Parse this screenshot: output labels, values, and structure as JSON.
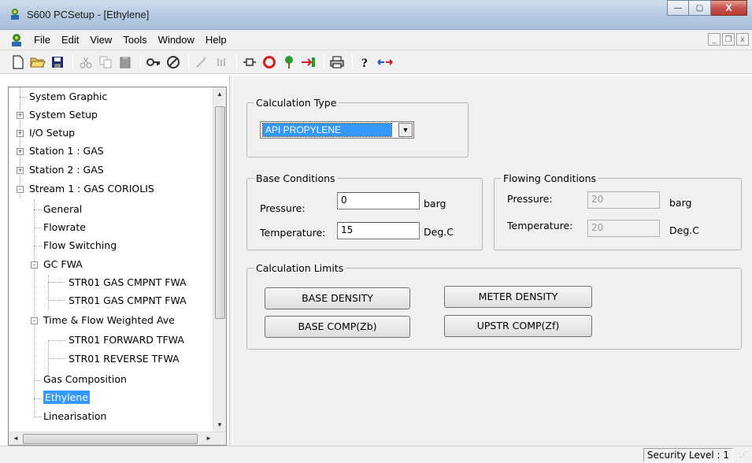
{
  "window": {
    "title": "S600 PCSetup - [Ethylene]",
    "controls": {
      "minimize": "—",
      "maximize": "▢",
      "close": "X"
    }
  },
  "menubar": {
    "items": [
      "File",
      "Edit",
      "View",
      "Tools",
      "Window",
      "Help"
    ],
    "mdi_controls": [
      "_",
      "❐",
      "x"
    ]
  },
  "toolbar": {
    "icons": [
      "new-file-icon",
      "open-folder-icon",
      "save-icon",
      "cut-icon",
      "copy-icon",
      "paste-icon",
      "key-icon",
      "connect-icon",
      "wand-icon",
      "bars-icon",
      "plug-icon",
      "circle-icon",
      "tree-icon",
      "arrow-into-icon",
      "printer-icon",
      "help-icon",
      "swap-arrows-icon"
    ]
  },
  "tree": {
    "items": [
      {
        "label": "System Graphic",
        "expander": "",
        "depth": 0
      },
      {
        "label": "System Setup",
        "expander": "+",
        "depth": 0
      },
      {
        "label": "I/O Setup",
        "expander": "+",
        "depth": 0
      },
      {
        "label": "Station 1 : GAS",
        "expander": "+",
        "depth": 0
      },
      {
        "label": "Station 2 : GAS",
        "expander": "+",
        "depth": 0
      },
      {
        "label": "Stream 1 : GAS CORIOLIS",
        "expander": "-",
        "depth": 0
      },
      {
        "label": "General",
        "expander": "",
        "depth": 1
      },
      {
        "label": "Flowrate",
        "expander": "",
        "depth": 1
      },
      {
        "label": "Flow Switching",
        "expander": "",
        "depth": 1
      },
      {
        "label": "GC FWA",
        "expander": "-",
        "depth": 1
      },
      {
        "label": "STR01 GAS CMPNT FWA",
        "expander": "",
        "depth": 2
      },
      {
        "label": "STR01 GAS CMPNT FWA",
        "expander": "",
        "depth": 2
      },
      {
        "label": "Time & Flow Weighted Ave",
        "expander": "-",
        "depth": 1
      },
      {
        "label": "STR01 FORWARD TFWA",
        "expander": "",
        "depth": 2
      },
      {
        "label": "STR01 REVERSE TFWA",
        "expander": "",
        "depth": 2
      },
      {
        "label": "Gas Composition",
        "expander": "",
        "depth": 1
      },
      {
        "label": "Ethylene",
        "expander": "",
        "depth": 1,
        "selected": true
      },
      {
        "label": "Linearisation",
        "expander": "",
        "depth": 1
      }
    ]
  },
  "calculation_type": {
    "legend": "Calculation Type",
    "selected": "API PROPYLENE"
  },
  "base_conditions": {
    "legend": "Base Conditions",
    "pressure_label": "Pressure:",
    "pressure_value": "0",
    "pressure_unit": "barg",
    "temperature_label": "Temperature:",
    "temperature_value": "15",
    "temperature_unit": "Deg.C"
  },
  "flowing_conditions": {
    "legend": "Flowing Conditions",
    "pressure_label": "Pressure:",
    "pressure_value": "20",
    "pressure_unit": "barg",
    "temperature_label": "Temperature:",
    "temperature_value": "20",
    "temperature_unit": "Deg.C"
  },
  "calculation_limits": {
    "legend": "Calculation Limits",
    "buttons": [
      "BASE DENSITY",
      "METER DENSITY",
      "BASE COMP(Zb)",
      "UPSTR COMP(Zf)"
    ]
  },
  "statusbar": {
    "security_level": "Security Level : 1"
  },
  "colors": {
    "selection": "#3399ff",
    "dialog_bg": "#f0f0f0"
  }
}
